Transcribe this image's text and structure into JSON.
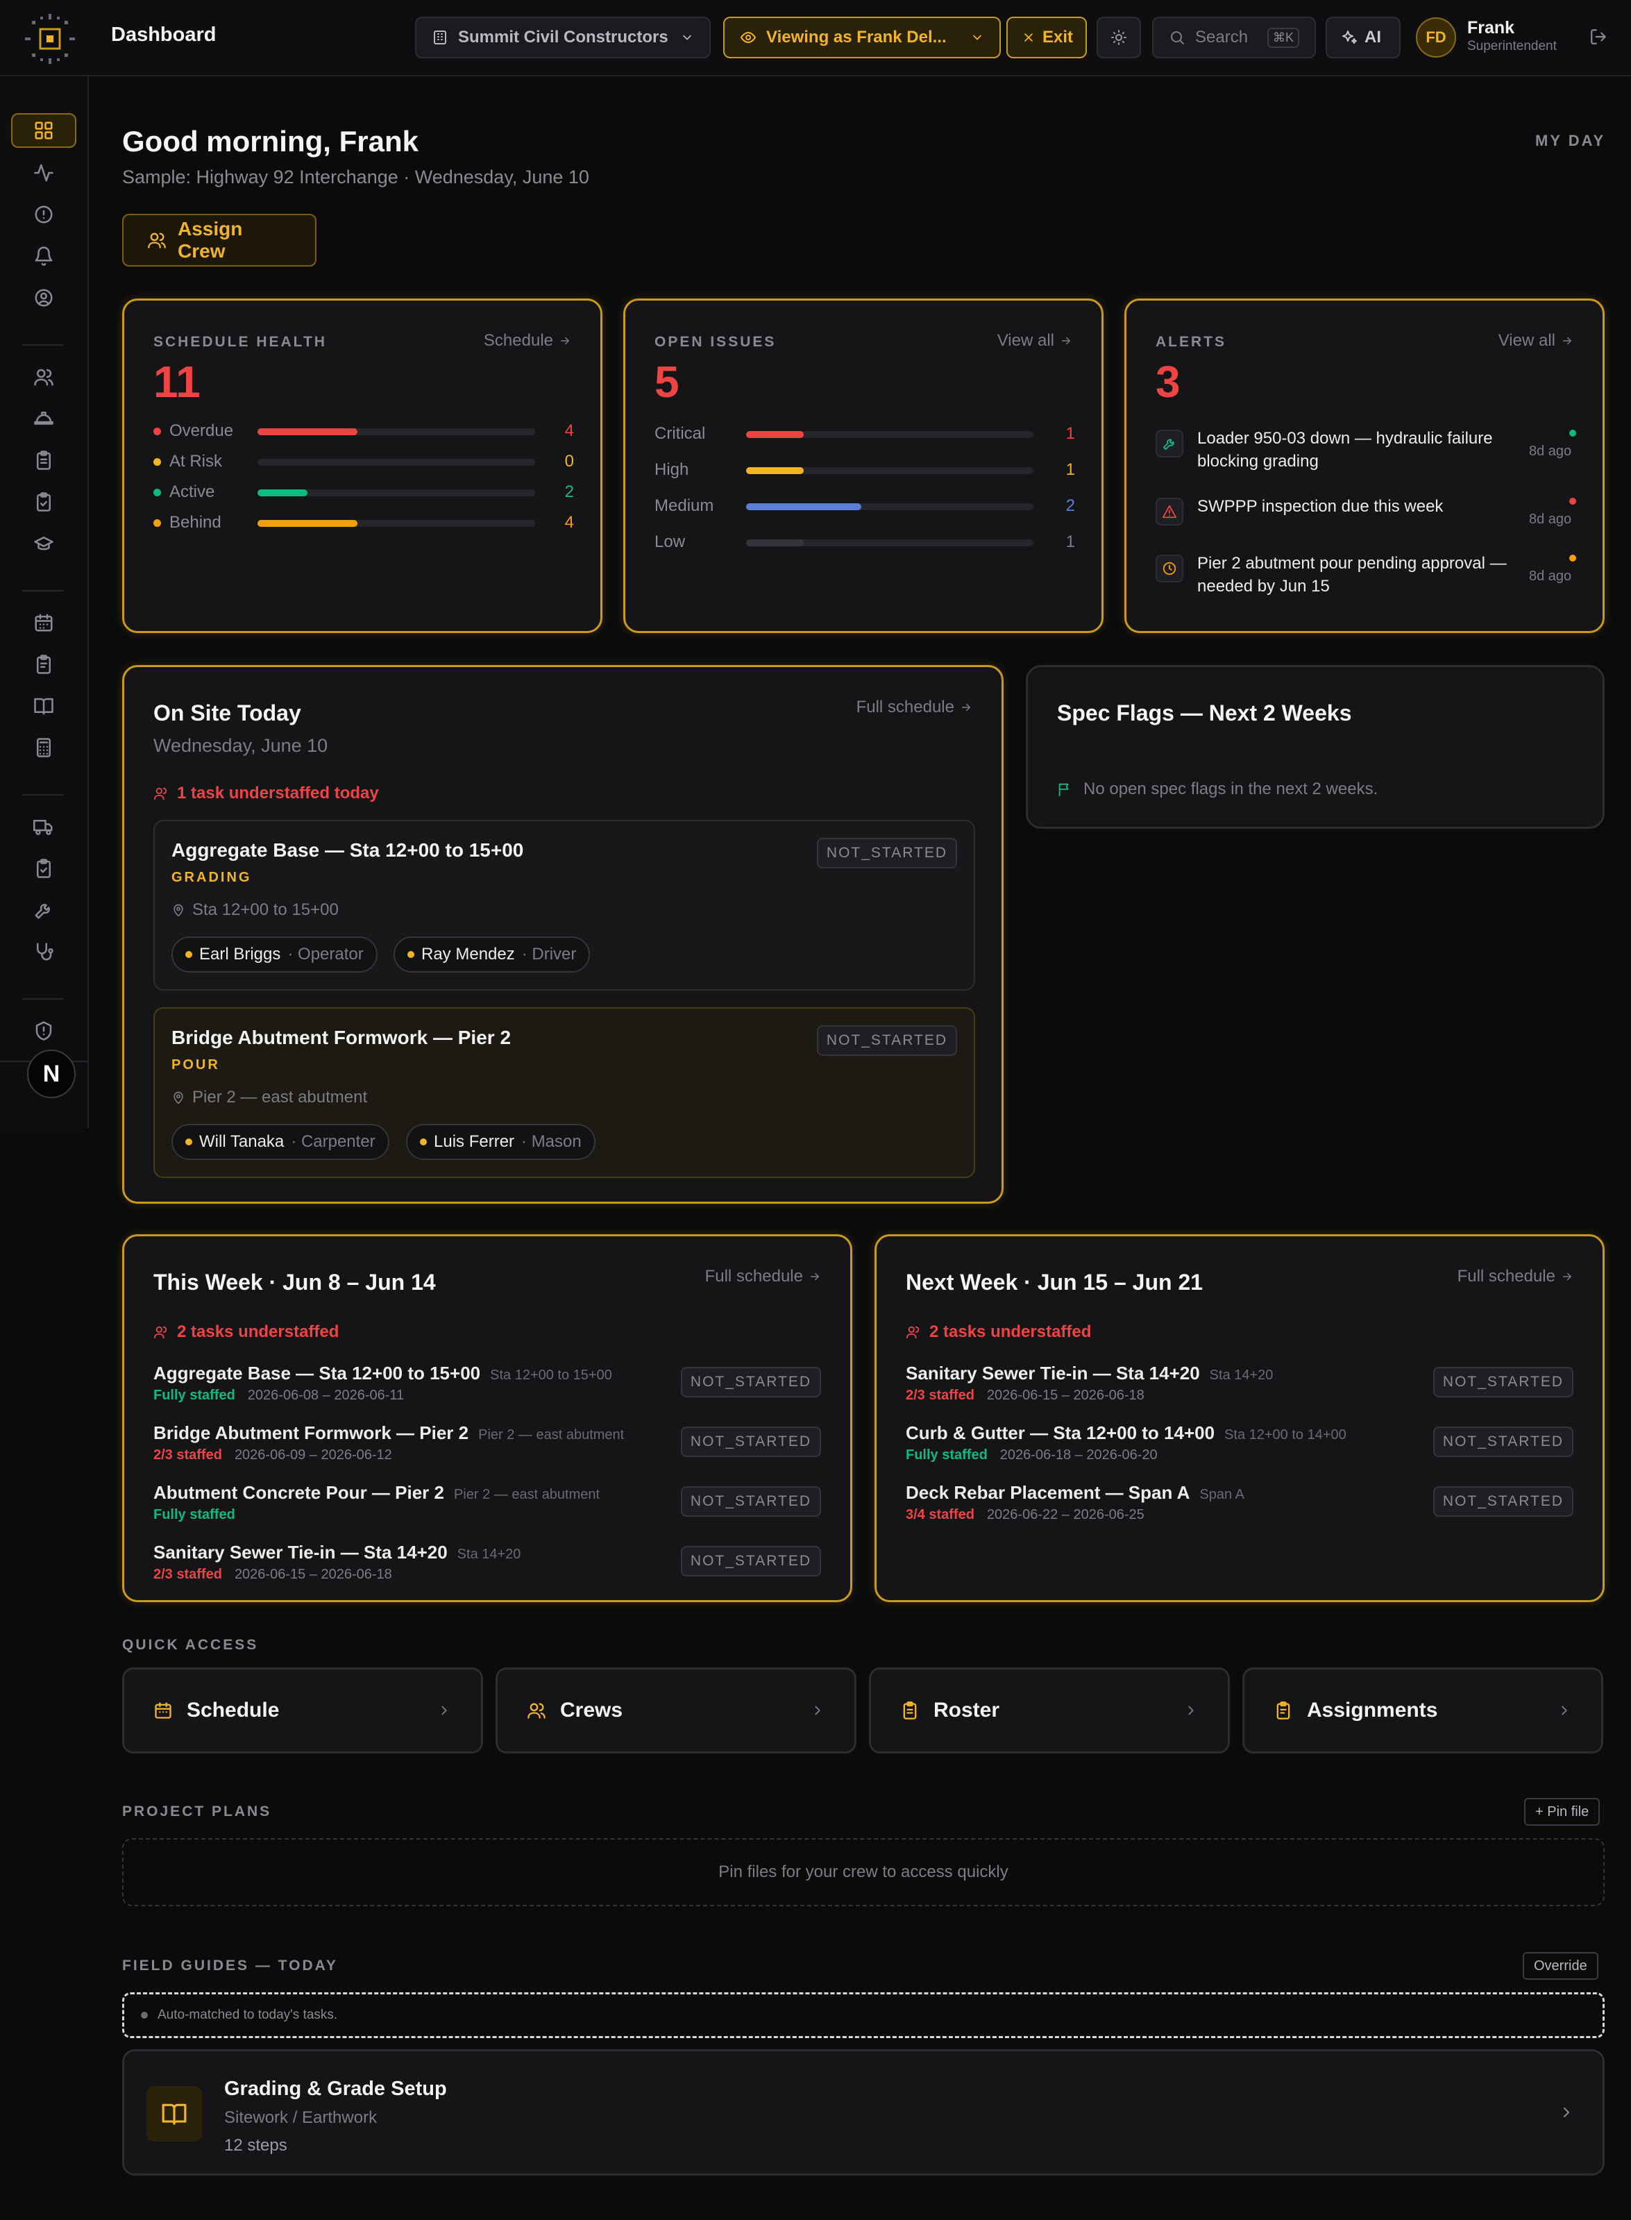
{
  "topbar": {
    "title": "Dashboard",
    "org": "Summit Civil Constructors",
    "viewing": "Viewing as Frank Del...",
    "exit": "Exit",
    "search": "Search",
    "kbd": "⌘K",
    "ai": "AI",
    "user": {
      "initials": "FD",
      "name": "Frank",
      "role": "Superintendent"
    }
  },
  "header": {
    "greeting": "Good morning, Frank",
    "subtitle": "Sample: Highway 92 Interchange · Wednesday, June 10",
    "my_day": "MY DAY",
    "assign_crew": "Assign Crew"
  },
  "schedule_health": {
    "eyebrow": "SCHEDULE HEALTH",
    "link": "Schedule",
    "total": "11",
    "rows": [
      {
        "label": "Overdue",
        "value": "4",
        "fraction": 0.36,
        "color": "#ef4444",
        "dot": "#ef4444"
      },
      {
        "label": "At Risk",
        "value": "0",
        "fraction": 0,
        "color": "#f0b429",
        "dot": "#f0b429"
      },
      {
        "label": "Active",
        "value": "2",
        "fraction": 0.18,
        "color": "#10b981",
        "dot": "#10b981"
      },
      {
        "label": "Behind",
        "value": "4",
        "fraction": 0.36,
        "color": "#f59e0b",
        "dot": "#f59e0b"
      }
    ]
  },
  "open_issues": {
    "eyebrow": "OPEN ISSUES",
    "link": "View all",
    "total": "5",
    "rows": [
      {
        "label": "Critical",
        "value": "1",
        "fraction": 0.2,
        "color": "#ef4444"
      },
      {
        "label": "High",
        "value": "1",
        "fraction": 0.2,
        "color": "#f0b429"
      },
      {
        "label": "Medium",
        "value": "2",
        "fraction": 0.4,
        "color": "#5b7fd6"
      },
      {
        "label": "Low",
        "value": "1",
        "fraction": 0.2,
        "color": "#34343a"
      }
    ]
  },
  "alerts": {
    "eyebrow": "ALERTS",
    "link": "View all",
    "total": "3",
    "items": [
      {
        "icon": "wrench-icon",
        "text": "Loader 950-03 down — hydraulic failure blocking grading",
        "ago": "8d ago",
        "dot": "#10b981"
      },
      {
        "icon": "warning-icon",
        "text": "SWPPP inspection due this week",
        "ago": "8d ago",
        "dot": "#ef4444"
      },
      {
        "icon": "clock-icon",
        "text": "Pier 2 abutment pour pending approval — needed by Jun 15",
        "ago": "8d ago",
        "dot": "#f59e0b"
      }
    ]
  },
  "on_site": {
    "title": "On Site Today",
    "date": "Wednesday, June 10",
    "link": "Full schedule",
    "warning": "1 task understaffed today",
    "tasks": [
      {
        "title": "Aggregate Base — Sta 12+00 to 15+00",
        "category": "GRADING",
        "location": "Sta 12+00 to 15+00",
        "status": "NOT_STARTED",
        "crew": [
          {
            "name": "Earl Briggs",
            "role": "· Operator"
          },
          {
            "name": "Ray Mendez",
            "role": "· Driver"
          }
        ]
      },
      {
        "title": "Bridge Abutment Formwork — Pier 2",
        "category": "POUR",
        "location": "Pier 2 — east abutment",
        "status": "NOT_STARTED",
        "crew": [
          {
            "name": "Will Tanaka",
            "role": "· Carpenter"
          },
          {
            "name": "Luis Ferrer",
            "role": "· Mason"
          }
        ]
      }
    ]
  },
  "spec_flags": {
    "title": "Spec Flags — Next 2 Weeks",
    "empty": "No open spec flags in the next 2 weeks."
  },
  "this_week": {
    "title": "This Week · Jun 8 – Jun 14",
    "link": "Full schedule",
    "warning": "2 tasks understaffed",
    "items": [
      {
        "title": "Aggregate Base — Sta 12+00 to 15+00",
        "loc": "Sta 12+00 to 15+00",
        "staff": "Fully staffed",
        "staff_color": "#10b981",
        "dates": "2026-06-08 – 2026-06-11",
        "status": "NOT_STARTED"
      },
      {
        "title": "Bridge Abutment Formwork — Pier 2",
        "loc": "Pier 2 — east abutment",
        "staff": "2/3 staffed",
        "staff_color": "#ef4444",
        "dates": "2026-06-09 – 2026-06-12",
        "status": "NOT_STARTED"
      },
      {
        "title": "Abutment Concrete Pour — Pier 2",
        "loc": "Pier 2 — east abutment",
        "staff": "Fully staffed",
        "staff_color": "#10b981",
        "dates": "",
        "status": "NOT_STARTED"
      },
      {
        "title": "Sanitary Sewer Tie-in — Sta 14+20",
        "loc": "Sta 14+20",
        "staff": "2/3 staffed",
        "staff_color": "#ef4444",
        "dates": "2026-06-15 – 2026-06-18",
        "status": "NOT_STARTED"
      }
    ]
  },
  "next_week": {
    "title": "Next Week · Jun 15 – Jun 21",
    "link": "Full schedule",
    "warning": "2 tasks understaffed",
    "items": [
      {
        "title": "Sanitary Sewer Tie-in — Sta 14+20",
        "loc": "Sta 14+20",
        "staff": "2/3 staffed",
        "staff_color": "#ef4444",
        "dates": "2026-06-15 – 2026-06-18",
        "status": "NOT_STARTED"
      },
      {
        "title": "Curb & Gutter — Sta 12+00 to 14+00",
        "loc": "Sta 12+00 to 14+00",
        "staff": "Fully staffed",
        "staff_color": "#10b981",
        "dates": "2026-06-18 – 2026-06-20",
        "status": "NOT_STARTED"
      },
      {
        "title": "Deck Rebar Placement — Span A",
        "loc": "Span A",
        "staff": "3/4 staffed",
        "staff_color": "#ef4444",
        "dates": "2026-06-22 – 2026-06-25",
        "status": "NOT_STARTED"
      }
    ]
  },
  "quick_access": {
    "label": "QUICK ACCESS",
    "items": [
      {
        "label": "Schedule",
        "icon": "calendar-icon"
      },
      {
        "label": "Crews",
        "icon": "users-icon"
      },
      {
        "label": "Roster",
        "icon": "clipboard-icon"
      },
      {
        "label": "Assignments",
        "icon": "clipboard-list-icon"
      }
    ]
  },
  "project_plans": {
    "label": "PROJECT PLANS",
    "pin": "+ Pin file",
    "empty": "Pin files for your crew to access quickly"
  },
  "field_guides": {
    "label": "FIELD GUIDES — TODAY",
    "override": "Override",
    "auto": "Auto-matched to today's tasks.",
    "guide": {
      "title": "Grading & Grade Setup",
      "category": "Sitework / Earthwork",
      "steps": "12 steps"
    }
  },
  "colors": {
    "accent": "#f0b429",
    "danger": "#ef4444",
    "success": "#10b981",
    "background": "#0b0b0c",
    "card": "#151518"
  }
}
